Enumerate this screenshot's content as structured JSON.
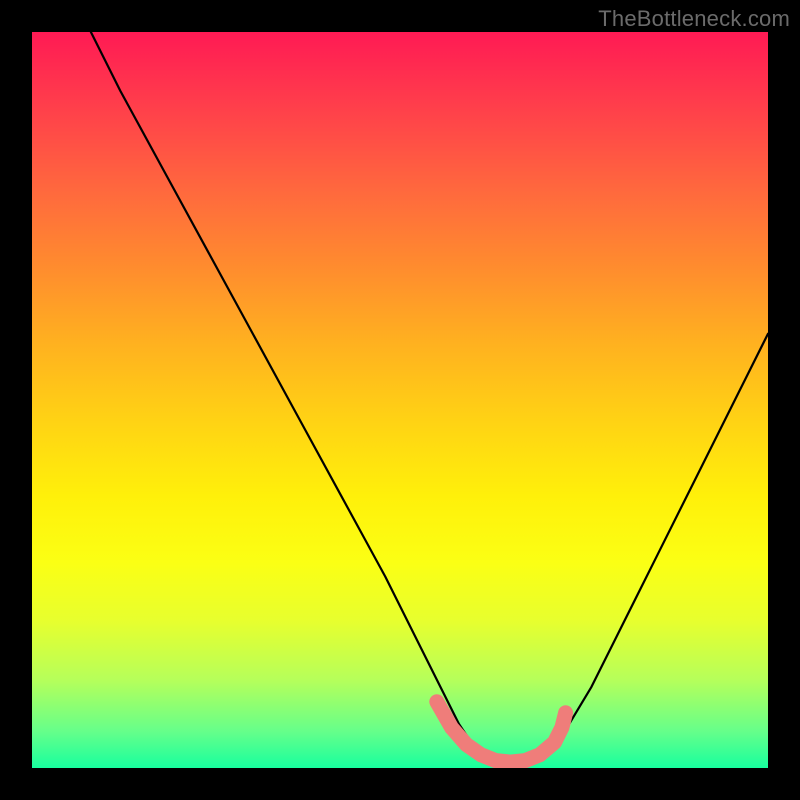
{
  "watermark": "TheBottleneck.com",
  "chart_data": {
    "type": "line",
    "title": "",
    "xlabel": "",
    "ylabel": "",
    "xlim": [
      0,
      100
    ],
    "ylim": [
      0,
      100
    ],
    "series": [
      {
        "name": "black-curve",
        "color": "#000000",
        "x": [
          8,
          12,
          18,
          24,
          30,
          36,
          42,
          48,
          53,
          56,
          58,
          60,
          63,
          66,
          69,
          71,
          73,
          76,
          80,
          85,
          90,
          96,
          100
        ],
        "y": [
          100,
          92,
          81,
          70,
          59,
          48,
          37,
          26,
          16,
          10,
          6,
          3,
          1,
          0.5,
          1,
          3,
          6,
          11,
          19,
          29,
          39,
          51,
          59
        ]
      },
      {
        "name": "pink-band",
        "color": "#ef7d7a",
        "x": [
          55,
          57,
          59,
          61,
          63,
          65,
          67,
          69,
          71,
          72,
          72.5
        ],
        "y": [
          9,
          5.5,
          3.2,
          1.8,
          1.0,
          0.8,
          1.0,
          1.8,
          3.5,
          5.5,
          7.5
        ]
      }
    ]
  }
}
